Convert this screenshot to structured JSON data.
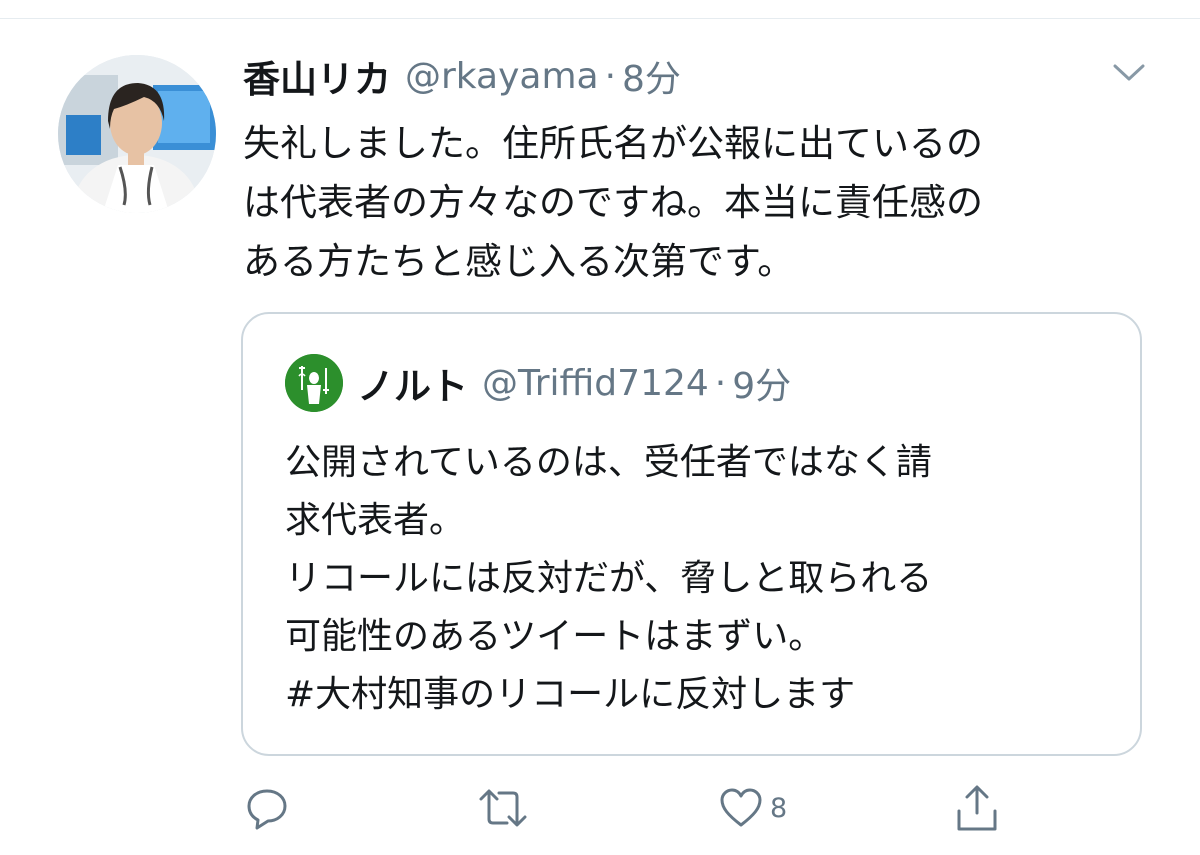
{
  "tweet": {
    "display_name": "香山リカ",
    "handle": "@rkayama",
    "separator": "·",
    "time": "8分",
    "text_lines": [
      "失礼しました。住所氏名が公報に出ているの",
      "は代表者の方々なのですね。本当に責任感の",
      "ある方たちと感じ入る次第です。"
    ]
  },
  "quote": {
    "display_name": "ノルト",
    "handle": "@Triffid7124",
    "separator": "·",
    "time": "9分",
    "text_lines": [
      "公開されているのは、受任者ではなく請",
      "求代表者。",
      "リコールには反対だが、脅しと取られる",
      "可能性のあるツイートはまずい。",
      "#大村知事のリコールに反対します"
    ]
  },
  "actions": {
    "reply_icon": "reply-icon",
    "retweet_icon": "retweet-icon",
    "like_icon": "heart-icon",
    "like_count": "8",
    "share_icon": "share-icon"
  },
  "colors": {
    "text": "#14171a",
    "secondary": "#657786",
    "border": "#ccd6dd",
    "quote_avatar_bg": "#2c8f2c"
  }
}
